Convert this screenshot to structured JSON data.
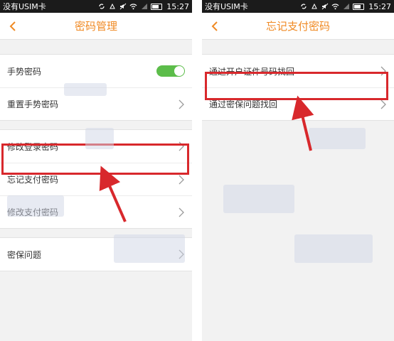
{
  "left": {
    "status": {
      "carrier": "没有USIM卡",
      "time": "15:27"
    },
    "header": {
      "title": "密码管理"
    },
    "group1": {
      "gesture_label": "手势密码",
      "gesture_on": true,
      "reset_label": "重置手势密码"
    },
    "group2": {
      "items": [
        "修改登录密码",
        "忘记支付密码",
        "修改支付密码"
      ]
    },
    "group3": {
      "security_label": "密保问题"
    }
  },
  "right": {
    "status": {
      "carrier": "没有USIM卡",
      "time": "15:27"
    },
    "header": {
      "title": "忘记支付密码"
    },
    "items": [
      "通过开户证件号码找回",
      "通过密保问题找回"
    ]
  },
  "colors": {
    "accent": "#f08a24",
    "highlight": "#d8282c",
    "toggle": "#5cbd4a"
  }
}
